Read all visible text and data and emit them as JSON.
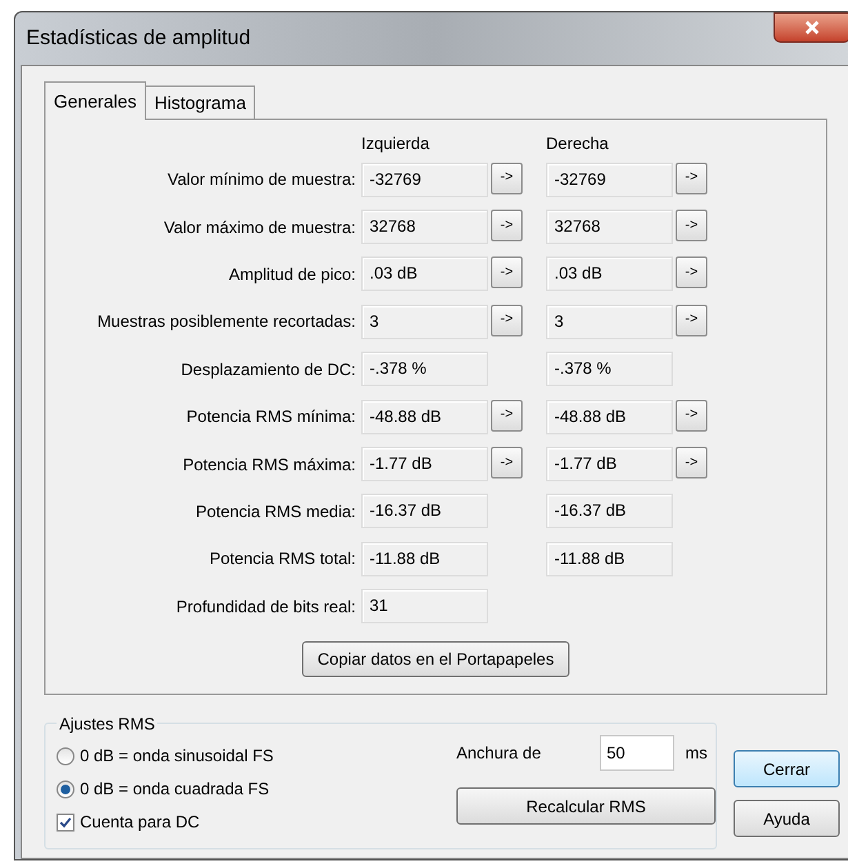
{
  "window": {
    "title": "Estadísticas de amplitud"
  },
  "tabs": [
    {
      "label": "Generales",
      "selected": true
    },
    {
      "label": "Histograma",
      "selected": false
    }
  ],
  "columns": [
    "Izquierda",
    "Derecha"
  ],
  "rows": [
    {
      "label": "Valor mínimo de muestra:",
      "values": [
        "-32769",
        "-32769"
      ],
      "button": "->"
    },
    {
      "label": "Valor máximo de muestra:",
      "values": [
        "32768",
        "32768"
      ],
      "button": "->"
    },
    {
      "label": "Amplitud de pico:",
      "values": [
        ".03 dB",
        ".03 dB"
      ],
      "button": "->"
    },
    {
      "label": "Muestras posiblemente recortadas:",
      "values": [
        "3",
        "3"
      ],
      "button": "->"
    },
    {
      "label": "Desplazamiento de DC:",
      "values": [
        "-.378 %",
        "-.378 %"
      ]
    },
    {
      "label": "Potencia RMS mínima:",
      "values": [
        "-48.88 dB",
        "-48.88 dB"
      ],
      "button": "->"
    },
    {
      "label": "Potencia RMS máxima:",
      "values": [
        "-1.77 dB",
        "-1.77 dB"
      ],
      "button": "->"
    },
    {
      "label": "Potencia RMS media:",
      "values": [
        "-16.37 dB",
        "-16.37 dB"
      ]
    },
    {
      "label": "Potencia RMS total:",
      "values": [
        "-11.88 dB",
        "-11.88 dB"
      ]
    },
    {
      "label": "Profundidad de bits real:",
      "values": [
        "31"
      ]
    }
  ],
  "copy_button": "Copiar datos en el Portapapeles",
  "rms_settings": {
    "title": "Ajustes RMS",
    "options": [
      {
        "label": "0 dB = onda sinusoidal FS",
        "selected": false
      },
      {
        "label": "0 dB = onda cuadrada FS",
        "selected": true
      }
    ],
    "dc_checkbox": {
      "label": "Cuenta para DC",
      "checked": true
    },
    "width_label": "Anchura de",
    "width_value": "50",
    "width_unit": "ms",
    "recalc_button": "Recalcular RMS"
  },
  "buttons": [
    "Cerrar",
    "Ayuda"
  ]
}
